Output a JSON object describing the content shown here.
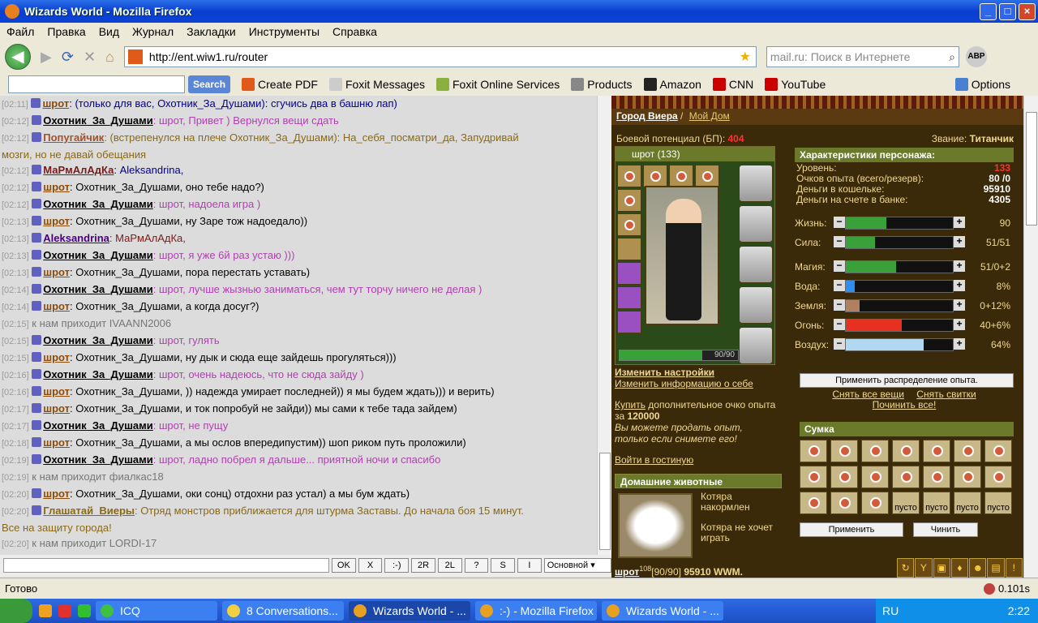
{
  "window": {
    "title": "Wizards World - Mozilla Firefox"
  },
  "menu": [
    "Файл",
    "Правка",
    "Вид",
    "Журнал",
    "Закладки",
    "Инструменты",
    "Справка"
  ],
  "nav": {
    "url": "http://ent.wiw1.ru/router",
    "search_placeholder": "mail.ru: Поиск в Интернете",
    "abp": "ABP"
  },
  "toolbar2": {
    "search_button": "Search",
    "items": [
      "Create PDF",
      "Foxit Messages",
      "Foxit Online Services",
      "Products",
      "Amazon",
      "CNN",
      "YouTube",
      "Options"
    ]
  },
  "chat": {
    "lines": [
      {
        "t": "[02:11]",
        "n": "шрот",
        "c": "n-shrot",
        "m": ": (только для вас, Охотник_За_Душами): сгучись два в башню лап)",
        "mc": "bl"
      },
      {
        "t": "[02:12]",
        "n": "Охотник_За_Душами",
        "c": "n-ohot",
        "m": ": шрот, Привет ) Вернулся вещи сдать",
        "mc": "pm"
      },
      {
        "t": "[02:12]",
        "n": "Попугайчик",
        "c": "n-popug",
        "m": ": (встрепенулся на плече Охотник_За_Душами): На_себя_посматри_да, Запудривай",
        "mc": "ev"
      },
      {
        "t": "",
        "n": "",
        "c": "",
        "m": "мозги, но не давай обещания",
        "mc": "ev"
      },
      {
        "t": "",
        "n": "",
        "c": "",
        "m": "",
        "mc": ""
      },
      {
        "t": "[02:12]",
        "n": "МаРмАлАдКа",
        "c": "n-marm",
        "m": ": Aleksandrina,",
        "mc": "bl"
      },
      {
        "t": "[02:12]",
        "n": "шрот",
        "c": "n-shrot",
        "m": ": Охотник_За_Душами, оно тебе надо?)",
        "mc": ""
      },
      {
        "t": "[02:12]",
        "n": "Охотник_За_Душами",
        "c": "n-ohot",
        "m": ": шрот, надоела игра )",
        "mc": "pm"
      },
      {
        "t": "[02:13]",
        "n": "шрот",
        "c": "n-shrot",
        "m": ": Охотник_За_Душами, ну Заре тож надоедало))",
        "mc": ""
      },
      {
        "t": "[02:13]",
        "n": "Aleksandrina",
        "c": "n-alek",
        "m": ": МаРмАлАдКа,",
        "mc": "n-marm"
      },
      {
        "t": "[02:13]",
        "n": "Охотник_За_Душами",
        "c": "n-ohot",
        "m": ": шрот, я уже 6й раз устаю )))",
        "mc": "pm"
      },
      {
        "t": "[02:13]",
        "n": "шрот",
        "c": "n-shrot",
        "m": ": Охотник_За_Душами, пора перестать уставать)",
        "mc": ""
      },
      {
        "t": "[02:14]",
        "n": "Охотник_За_Душами",
        "c": "n-ohot",
        "m": ": шрот, лучше жызнью заниматься, чем тут торчу ничего не делая )",
        "mc": "pm"
      },
      {
        "t": "[02:14]",
        "n": "шрот",
        "c": "n-shrot",
        "m": ": Охотник_За_Душами, а когда досуг?)",
        "mc": ""
      },
      {
        "t": "[02:15]",
        "n": "",
        "c": "",
        "m": " к нам приходит IVAANN2006",
        "mc": "sys"
      },
      {
        "t": "[02:15]",
        "n": "Охотник_За_Душами",
        "c": "n-ohot",
        "m": ": шрот, гулять",
        "mc": "pm"
      },
      {
        "t": "[02:15]",
        "n": "шрот",
        "c": "n-shrot",
        "m": ": Охотник_За_Душами, ну дык и сюда еще зайдешь прогуляться)))",
        "mc": ""
      },
      {
        "t": "[02:16]",
        "n": "Охотник_За_Душами",
        "c": "n-ohot",
        "m": ": шрот, очень надеюсь, что не сюда зайду )",
        "mc": "pm"
      },
      {
        "t": "[02:16]",
        "n": "шрот",
        "c": "n-shrot",
        "m": ": Охотник_За_Душами, )) надежда умирает последней)) я мы будем ждать))) и верить)",
        "mc": ""
      },
      {
        "t": "[02:17]",
        "n": "шрот",
        "c": "n-shrot",
        "m": ": Охотник_За_Душами, и ток попробуй не зайди)) мы сами к тебе тада зайдем)",
        "mc": ""
      },
      {
        "t": "[02:17]",
        "n": "Охотник_За_Душами",
        "c": "n-ohot",
        "m": ": шрот, не пущу",
        "mc": "pm"
      },
      {
        "t": "[02:18]",
        "n": "шрот",
        "c": "n-shrot",
        "m": ": Охотник_За_Душами, а мы ослов впередипустим)) шоп риком путь проложили)",
        "mc": ""
      },
      {
        "t": "[02:19]",
        "n": "Охотник_За_Душами",
        "c": "n-ohot",
        "m": ": шрот, ладно побрел я дальше... приятной ночи и спасибо",
        "mc": "pm"
      },
      {
        "t": "[02:19]",
        "n": "",
        "c": "",
        "m": " к нам приходит фиалкас18",
        "mc": "sys"
      },
      {
        "t": "[02:20]",
        "n": "шрот",
        "c": "n-shrot",
        "m": ": Охотник_За_Душами, оки сонц) отдохни раз устал) а мы бум ждать)",
        "mc": ""
      },
      {
        "t": "[02:20]",
        "n": "Глашатай_Виеры",
        "c": "n-glash",
        "m": ": Отряд монстров приближается для штурма Заставы. До начала боя 15 минут.",
        "mc": "ev"
      },
      {
        "t": "",
        "n": "",
        "c": "",
        "m": "Все на защиту города!",
        "mc": "ev"
      },
      {
        "t": "[02:20]",
        "n": "",
        "c": "",
        "m": " к нам приходит LORDI-17",
        "mc": "sys"
      },
      {
        "t": "[02:21]",
        "n": "",
        "c": "",
        "m": " к нам приходит Barguman",
        "mc": "sys"
      },
      {
        "t": "[02:21]",
        "n": "шрот",
        "c": "n-shrot",
        "m": ": Охотник_За_Душами, эх а щас бы на заставе так пригодился)",
        "mc": ""
      },
      {
        "t": "[02:22]",
        "n": "",
        "c": "",
        "m": " к нам приходит vicplay",
        "mc": "sys"
      }
    ],
    "buttons": [
      "OK",
      "X",
      ":-)",
      "2R",
      "2L",
      "?",
      "S",
      "I"
    ],
    "channel": "Основной"
  },
  "game": {
    "city": "Город Виера",
    "home": "Мой Дом",
    "bp_label": "Боевой потенциал (БП):",
    "bp": "404",
    "rank_label": "Звание:",
    "rank": "Титанчик",
    "char_name": "шрот",
    "char_level": "(133)",
    "hp_text": "90/90",
    "links": [
      "Изменить настройки",
      "Изменить информацию о себе"
    ],
    "buy": "Купить",
    "buy_text": "дополнительное очко опыта за",
    "buy_price": "120000",
    "sell_text": "Вы можете продать опыт, только если снимете его!",
    "lounge": "Войти в гостиную",
    "pets_title": "Домашние животные",
    "pet_status": [
      "Котяра накормлен",
      "Котяра не хочет играть"
    ],
    "bottom_name": "шрот",
    "bottom_lvl": "108",
    "bottom_hp": "[90/90]",
    "bottom_money": "95910 WWM.",
    "stats_title": "Характеристики персонажа:",
    "stats": [
      {
        "l": "Уровень:",
        "v": "133",
        "red": true
      },
      {
        "l": "Очков опыта (всего/резерв):",
        "v": "80 /0",
        "red": false
      },
      {
        "l": "Деньги в кошельке:",
        "v": "95910",
        "red": false
      },
      {
        "l": "Деньги на счете в банке:",
        "v": "4305",
        "red": false
      }
    ],
    "bars": [
      {
        "l": "Жизнь:",
        "v": "90",
        "fill": 0.38,
        "color": "#3aa03a"
      },
      {
        "l": "Сила:",
        "v": "51/51",
        "fill": 0.27,
        "color": "#3aa03a"
      },
      {
        "l": "Магия:",
        "v": "51/0+2",
        "fill": 0.47,
        "color": "#3aa03a"
      },
      {
        "l": "Вода:",
        "v": "8%",
        "fill": 0.08,
        "color": "#2f8ef0"
      },
      {
        "l": "Земля:",
        "v": "0+12%",
        "fill": 0.13,
        "color": "#b08060"
      },
      {
        "l": "Огонь:",
        "v": "40+6%",
        "fill": 0.52,
        "color": "#e83020"
      },
      {
        "l": "Воздух:",
        "v": "64%",
        "fill": 0.73,
        "color": "#b0d8f0"
      }
    ],
    "apply_exp": "Применить распределение опыта.",
    "remove_items": "Снять все вещи",
    "remove_scrolls": "Снять свитки",
    "repair_all": "Починить все!",
    "bag_title": "Сумка",
    "empty_label": "пусто",
    "apply_btn": "Применить",
    "fix_btn": "Чинить"
  },
  "status": {
    "text": "Готово",
    "time": "0.101s"
  },
  "taskbar": {
    "tasks": [
      "ICQ",
      "8 Conversations...",
      "Wizards World - ...",
      ":-) - Mozilla Firefox",
      "Wizards World - ..."
    ],
    "lang": "RU",
    "clock": "2:22"
  }
}
